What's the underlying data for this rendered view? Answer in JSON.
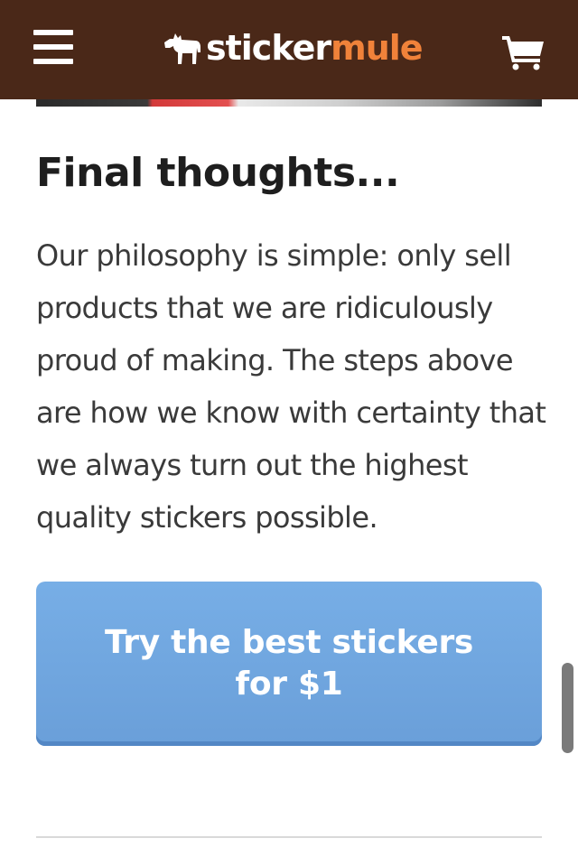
{
  "header": {
    "menu_icon": "hamburger-menu-icon",
    "logo": {
      "part1": "sticker",
      "part2": "mule",
      "icon": "mule-logo-icon"
    },
    "cart_icon": "shopping-cart-icon",
    "colors": {
      "background": "#4a2818",
      "logo_accent": "#f0823a"
    }
  },
  "article": {
    "title": "Final thoughts...",
    "paragraph": "Our philosophy is simple: only sell products that we are ridiculously proud of making. The steps above are how we know with certainty that we always turn out the highest quality stickers possible.",
    "cta_label": "Try the best stickers for $1",
    "cta_color": "#6a9fd9"
  }
}
